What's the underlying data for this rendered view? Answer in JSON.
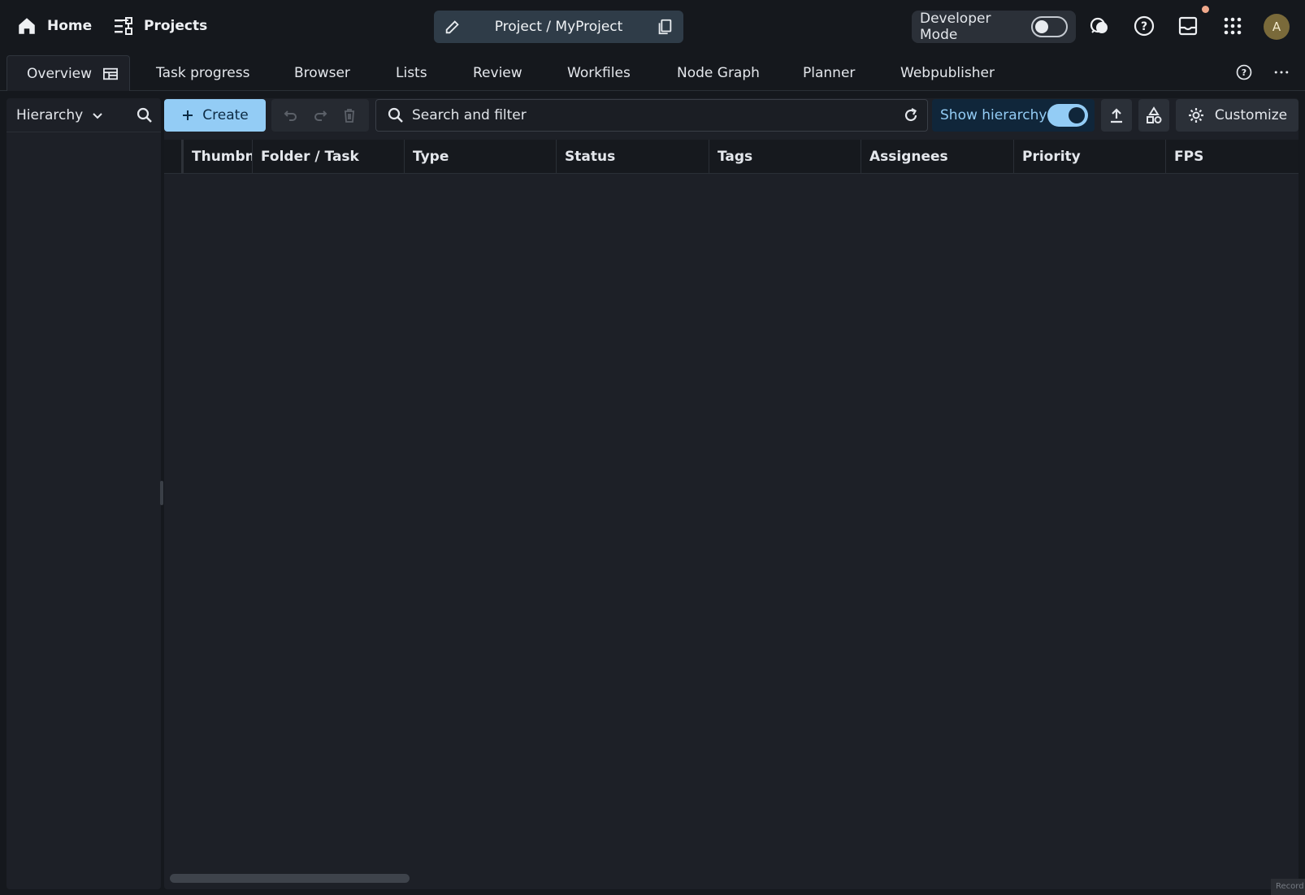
{
  "topbar": {
    "home_label": "Home",
    "projects_label": "Projects",
    "project_title": "Project / MyProject",
    "developer_mode_label": "Developer Mode",
    "developer_mode_on": false,
    "avatar_initial": "A"
  },
  "tabs": [
    {
      "label": "Overview",
      "active": true
    },
    {
      "label": "Task progress"
    },
    {
      "label": "Browser"
    },
    {
      "label": "Lists"
    },
    {
      "label": "Review"
    },
    {
      "label": "Workfiles"
    },
    {
      "label": "Node Graph"
    },
    {
      "label": "Planner"
    },
    {
      "label": "Webpublisher"
    }
  ],
  "sidebar": {
    "mode_label": "Hierarchy"
  },
  "toolbar": {
    "create_label": "Create",
    "search_placeholder": "Search and filter",
    "show_hierarchy_label": "Show hierarchy",
    "show_hierarchy_on": true,
    "customize_label": "Customize"
  },
  "table": {
    "columns": [
      "Thumbnail",
      "Folder / Task",
      "Type",
      "Status",
      "Tags",
      "Assignees",
      "Priority",
      "FPS"
    ],
    "thumbnail_visible_label": "Thumbn"
  },
  "footer": {
    "record_label": "Record"
  },
  "colors": {
    "accent": "#93ccf5",
    "background": "#15181d",
    "panel": "#1d2027",
    "notification": "#f0a98c"
  }
}
